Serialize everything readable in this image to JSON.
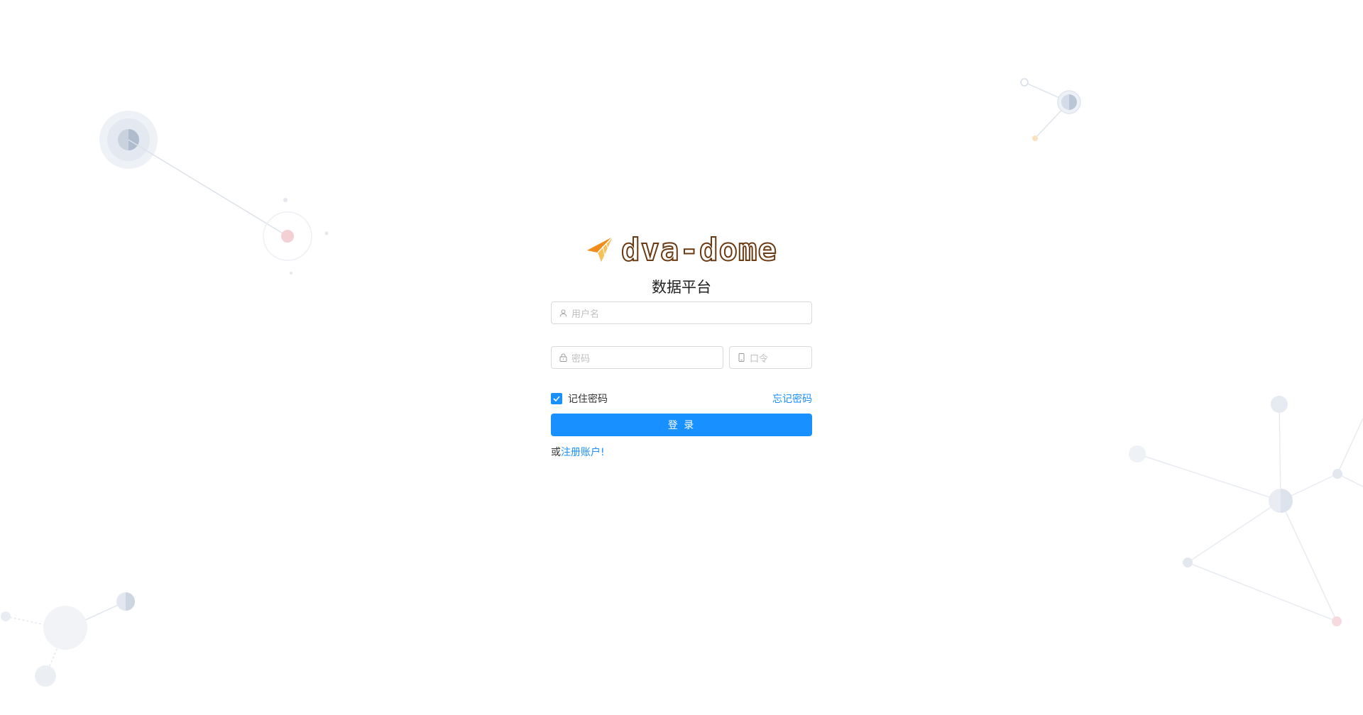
{
  "brand": {
    "logo_text": "dva-dome",
    "subtitle": "数据平台",
    "logo_accent": "#f5a623",
    "logo_stroke": "#6b3a12"
  },
  "form": {
    "username_placeholder": "用户名",
    "password_placeholder": "密码",
    "otp_placeholder": "口令",
    "remember_label": "记住密码",
    "remember_checked": true,
    "forgot_label": "忘记密码",
    "login_label": "登 录",
    "register_prefix": "或",
    "register_link": "注册账户!"
  },
  "icons": {
    "username": "user-icon",
    "password": "lock-icon",
    "otp": "mobile-icon",
    "remember": "check-icon",
    "logo": "paper-plane-icon"
  },
  "colors": {
    "primary": "#1890ff",
    "border": "#d9d9d9",
    "placeholder": "#bfbfbf"
  }
}
